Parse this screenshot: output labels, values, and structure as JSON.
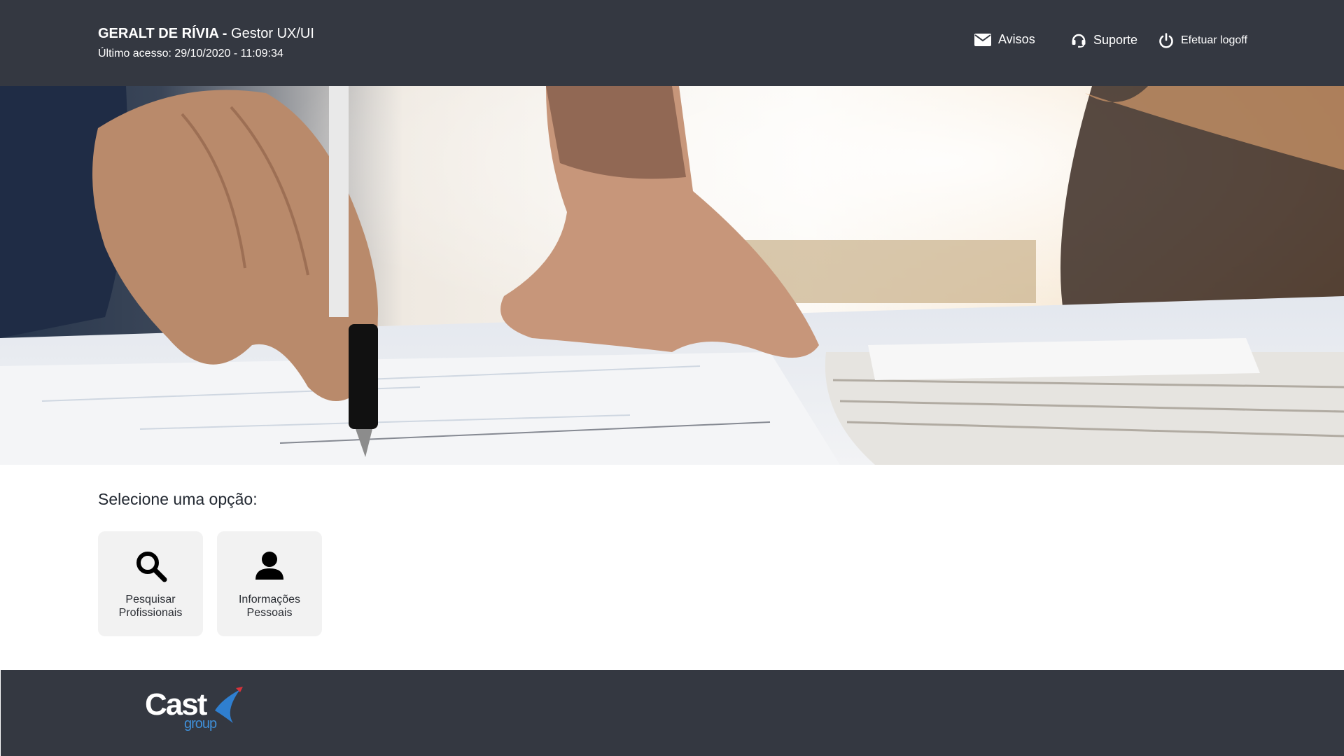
{
  "header": {
    "user_name": "GERALT DE RÍVIA",
    "separator": " - ",
    "role": "Gestor UX/UI",
    "last_access": "Último acesso: 29/10/2020 - 11:09:34",
    "nav": {
      "notices_label": "Avisos",
      "notices_icon": "envelope-icon",
      "support_label": "Suporte",
      "support_icon": "headset-icon",
      "logoff_label": "Efetuar logoff",
      "logoff_icon": "power-icon"
    }
  },
  "main": {
    "title": "Selecione uma opção:",
    "options": [
      {
        "line1": "Pesquisar",
        "line2": "Profissionais",
        "icon": "search-icon"
      },
      {
        "line1": "Informações",
        "line2": "Pessoais",
        "icon": "user-icon"
      }
    ]
  },
  "footer": {
    "logo_text": "Cast",
    "logo_sub": "group"
  },
  "colors": {
    "header_bg": "#343841",
    "footer_bg": "#343841",
    "card_bg": "#f2f2f2",
    "logo_accent": "#3f8fd8"
  }
}
